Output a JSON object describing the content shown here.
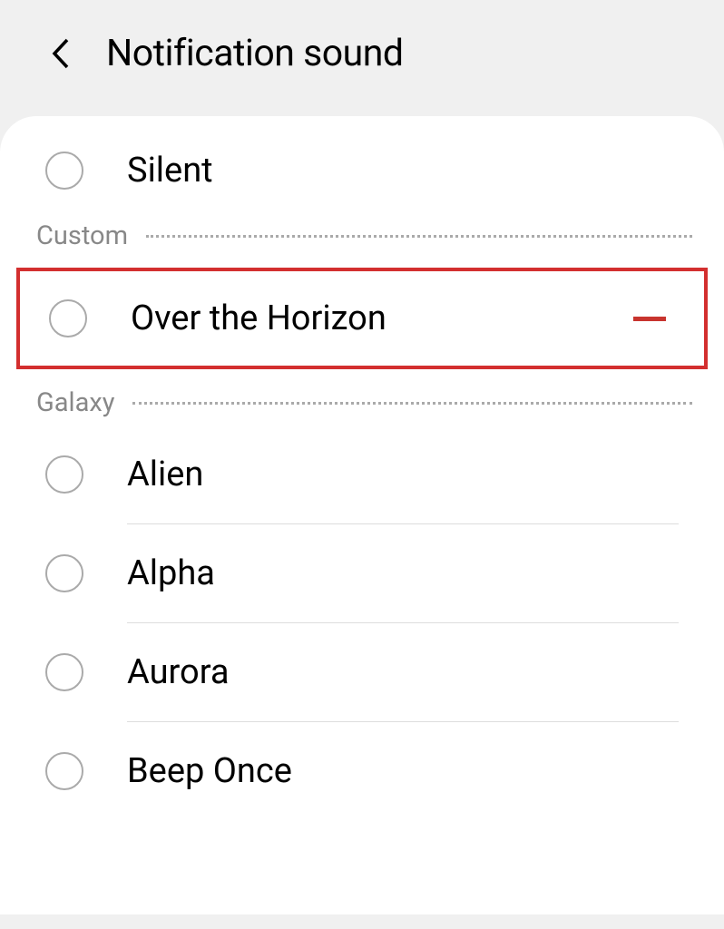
{
  "header": {
    "title": "Notification sound"
  },
  "silent": {
    "label": "Silent"
  },
  "sections": {
    "custom": {
      "label": "Custom",
      "items": [
        {
          "label": "Over the Horizon"
        }
      ]
    },
    "galaxy": {
      "label": "Galaxy",
      "items": [
        {
          "label": "Alien"
        },
        {
          "label": "Alpha"
        },
        {
          "label": "Aurora"
        },
        {
          "label": "Beep Once"
        }
      ]
    }
  }
}
